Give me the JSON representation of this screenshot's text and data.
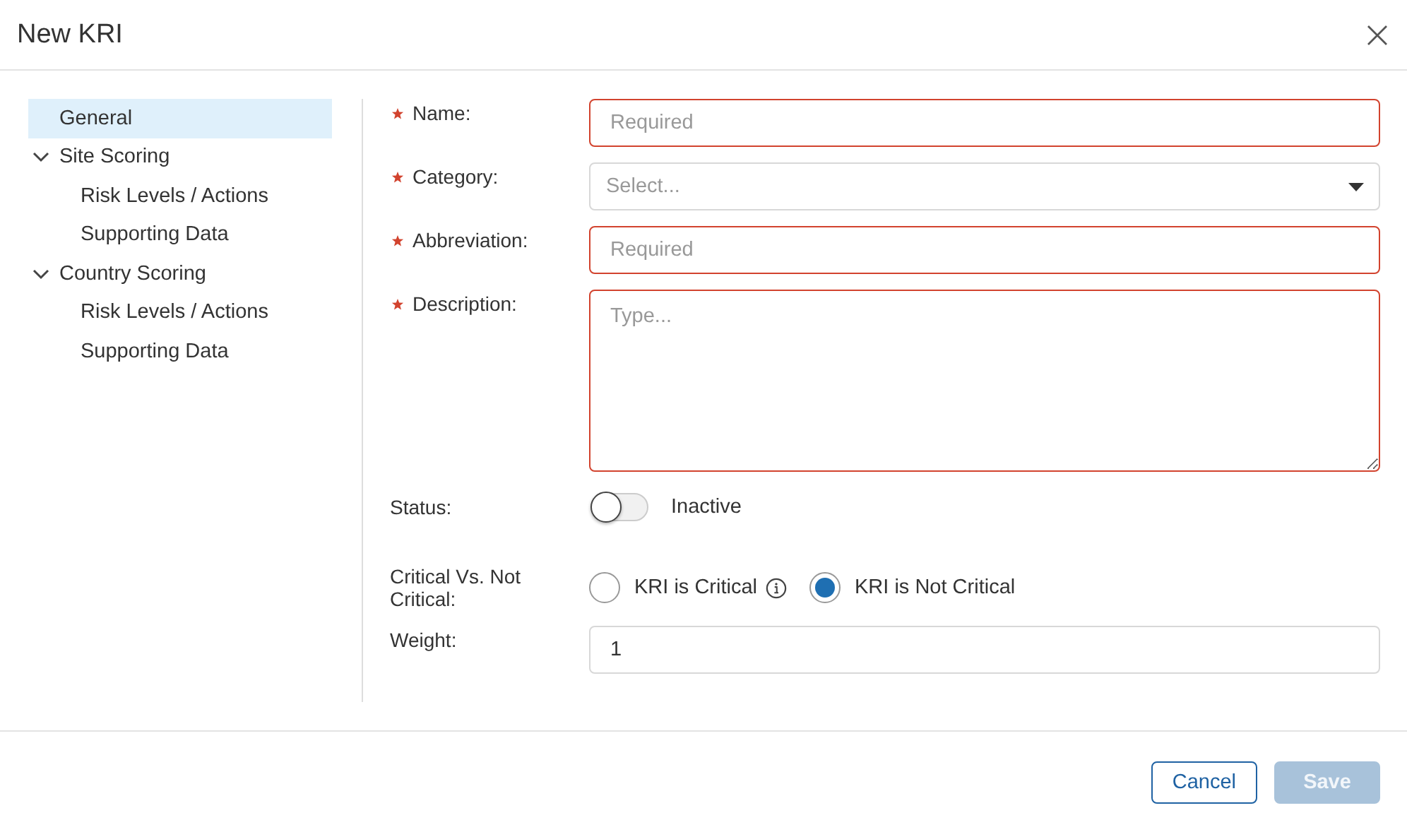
{
  "dialog": {
    "title": "New KRI"
  },
  "nav": {
    "items": [
      {
        "label": "General",
        "selected": true
      },
      {
        "label": "Site Scoring",
        "selected": false,
        "expanded": true,
        "children": [
          {
            "label": "Risk Levels / Actions",
            "selected": false
          },
          {
            "label": "Supporting Data",
            "selected": false
          }
        ]
      },
      {
        "label": "Country Scoring",
        "selected": false,
        "expanded": true,
        "children": [
          {
            "label": "Risk Levels / Actions",
            "selected": false
          },
          {
            "label": "Supporting Data",
            "selected": false
          }
        ]
      }
    ]
  },
  "form": {
    "fields": [
      {
        "kind": "text",
        "label": "Name:",
        "required": true,
        "invalid": true,
        "placeholder": "Required"
      },
      {
        "kind": "select",
        "label": "Category:",
        "required": true,
        "invalid": false,
        "placeholder": "Select..."
      },
      {
        "kind": "text",
        "label": "Abbreviation:",
        "required": true,
        "invalid": true,
        "placeholder": "Required"
      },
      {
        "kind": "textarea",
        "label": "Description:",
        "required": true,
        "invalid": true,
        "placeholder": "Type..."
      },
      {
        "kind": "toggle",
        "label": "Status:",
        "required": false,
        "on": false,
        "text": "Inactive"
      },
      {
        "kind": "radio",
        "label": "Critical Vs. Not Critical:",
        "required": false,
        "options": [
          {
            "label": "KRI is Critical",
            "selected": false,
            "info": true
          },
          {
            "label": "KRI is Not Critical",
            "selected": true,
            "info": false
          }
        ]
      },
      {
        "kind": "text",
        "label": "Weight:",
        "required": false,
        "invalid": false,
        "value": "1"
      }
    ]
  },
  "buttons": [
    {
      "label": "Cancel",
      "kind": "secondary",
      "disabled": false
    },
    {
      "label": "Save",
      "kind": "primary",
      "disabled": true
    }
  ]
}
